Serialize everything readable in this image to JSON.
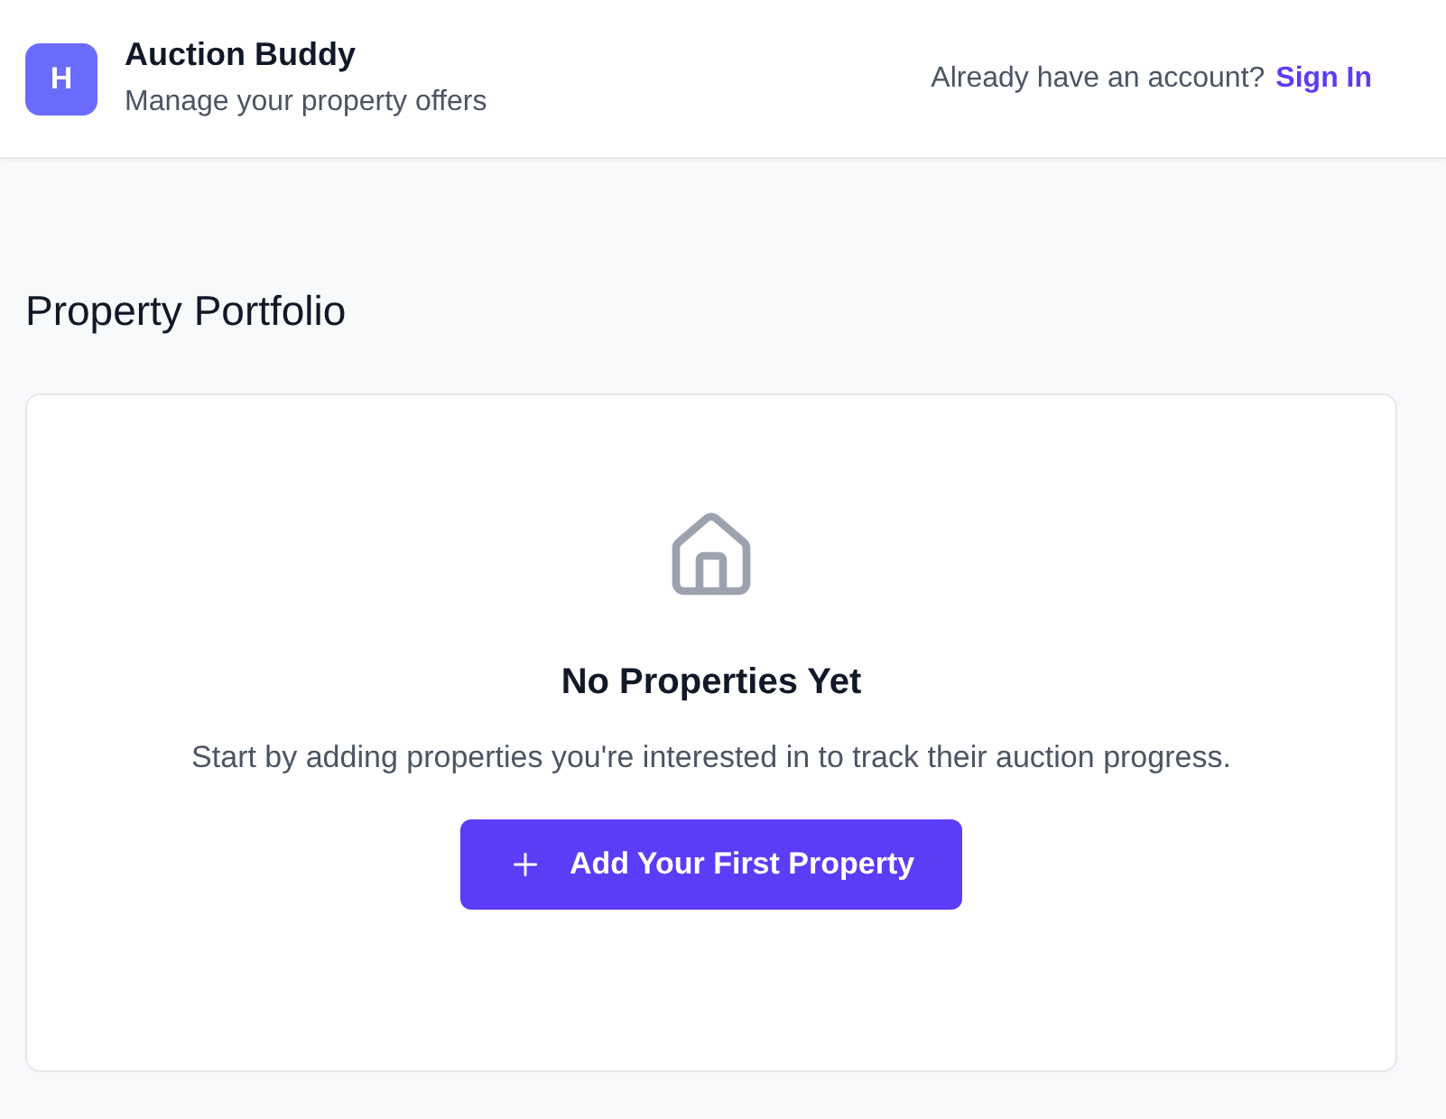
{
  "header": {
    "logo_letter": "H",
    "title": "Auction Buddy",
    "subtitle": "Manage your property offers",
    "account_prompt": "Already have an account?",
    "sign_in_link": "Sign In"
  },
  "section": {
    "title": "Property Portfolio"
  },
  "empty_state": {
    "title": "No Properties Yet",
    "description": "Start by adding properties you're interested in to track their auction progress.",
    "button": "Add Your First Property"
  }
}
